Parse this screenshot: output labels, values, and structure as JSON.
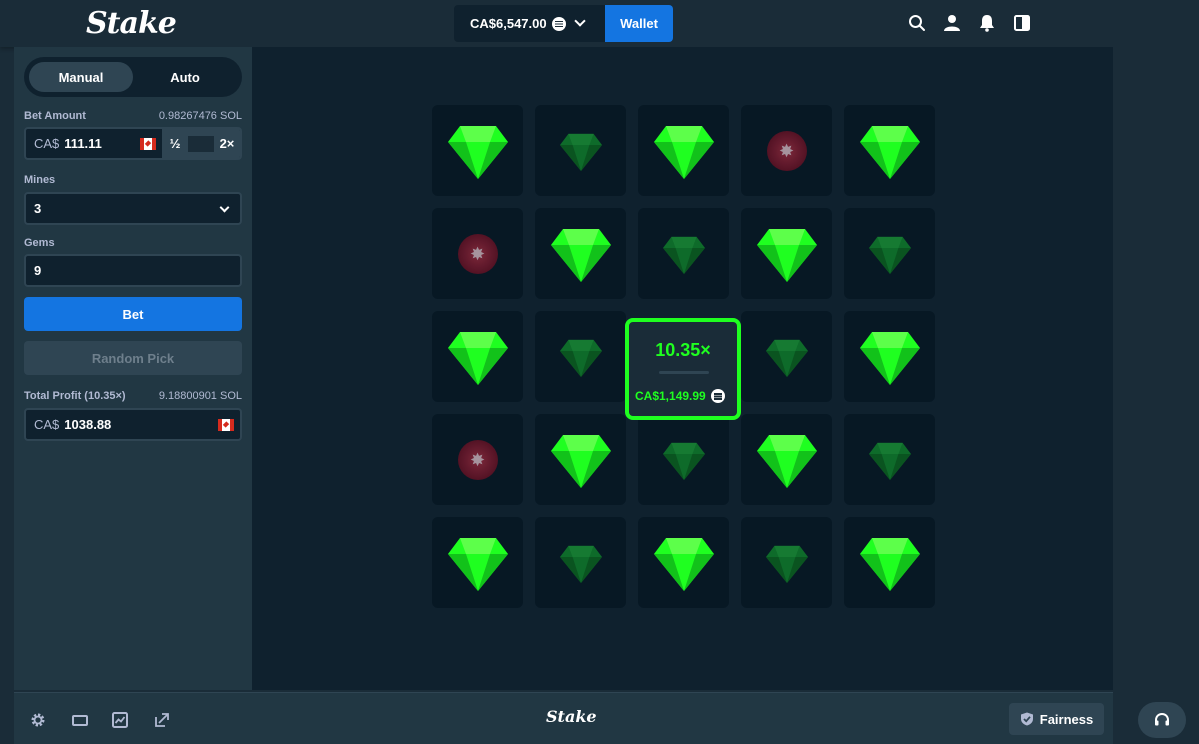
{
  "header": {
    "logo": "Stake",
    "balance": "CA$6,547.00",
    "wallet_label": "Wallet",
    "icons": [
      "search-icon",
      "user-icon",
      "notification-icon",
      "sidebar-toggle-icon"
    ]
  },
  "left_panel": {
    "tabs": [
      {
        "label": "Manual",
        "active": true
      },
      {
        "label": "Auto",
        "active": false
      }
    ],
    "bet_amount_label": "Bet Amount",
    "bet_amount_crypto": "0.98267476 SOL",
    "bet_currency": "CA$",
    "bet_amount_value": "111.11",
    "half_label": "½",
    "double_label": "2×",
    "mines_label": "Mines",
    "mines_value": "3",
    "gems_label": "Gems",
    "gems_value": "9",
    "bet_button": "Bet",
    "random_pick_button": "Random Pick",
    "total_profit_label": "Total Profit (10.35×)",
    "total_profit_crypto": "9.18800901 SOL",
    "profit_currency": "CA$",
    "profit_value": "1038.88"
  },
  "game": {
    "board": [
      [
        "gem",
        "gem-dim",
        "gem",
        "mine",
        "gem"
      ],
      [
        "mine",
        "gem",
        "gem-dim",
        "gem",
        "gem-dim"
      ],
      [
        "gem",
        "gem-dim",
        "result",
        "gem-dim",
        "gem"
      ],
      [
        "mine",
        "gem",
        "gem-dim",
        "gem",
        "gem-dim"
      ],
      [
        "gem",
        "gem-dim",
        "gem",
        "gem-dim",
        "gem"
      ]
    ],
    "win_multiplier": "10.35×",
    "win_amount": "CA$1,149.99",
    "colors": {
      "gem": "#1fff20",
      "gem_dim": "#0e6b2a",
      "mine": "#6b1a2e",
      "accent": "#1475e1"
    }
  },
  "footer": {
    "logo": "Stake",
    "fairness_label": "Fairness",
    "icons": [
      "settings-icon",
      "theatre-mode-icon",
      "stats-icon",
      "popout-icon"
    ]
  }
}
